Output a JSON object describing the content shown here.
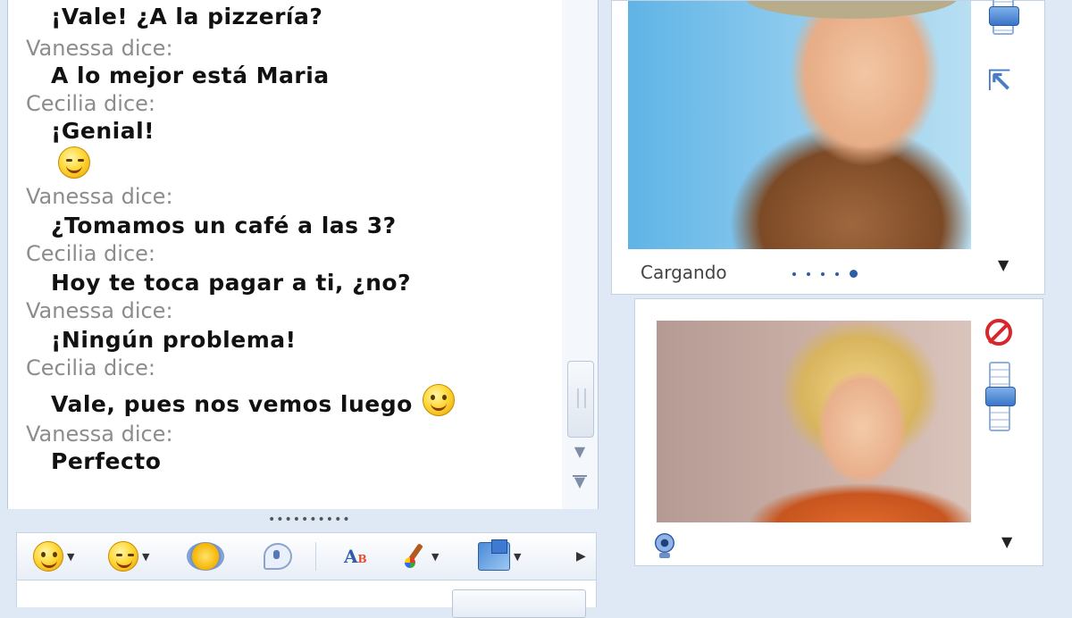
{
  "conversation": {
    "messages": [
      {
        "sender": "",
        "text": "¡Vale! ¿A la pizzería?",
        "emoticon": ""
      },
      {
        "sender": "Vanessa dice:",
        "text": "A lo mejor está Maria",
        "emoticon": ""
      },
      {
        "sender": "Cecilia dice:",
        "text": "¡Genial!",
        "emoticon": "wink"
      },
      {
        "sender": "Vanessa dice:",
        "text": "¿Tomamos un café a las 3?",
        "emoticon": ""
      },
      {
        "sender": "Cecilia dice:",
        "text": "Hoy te toca pagar a ti, ¿no?",
        "emoticon": ""
      },
      {
        "sender": "Vanessa dice:",
        "text": "¡Ningún problema!",
        "emoticon": ""
      },
      {
        "sender": "Cecilia dice:",
        "text": "Vale, pues nos vemos luego",
        "emoticon": "smile"
      },
      {
        "sender": "Vanessa dice:",
        "text": "Perfecto",
        "emoticon": ""
      }
    ]
  },
  "contact_video": {
    "status_text": "Cargando"
  },
  "toolbar": {
    "font_icon_text": "A",
    "font_icon_sub": "B",
    "icons": [
      "smile-emoticon-icon",
      "wink-emoticon-icon",
      "nudge-icon",
      "voice-clip-icon",
      "font-icon",
      "brush-icon",
      "background-icon",
      "more-icon"
    ]
  },
  "colors": {
    "sender": "#8c8c8c",
    "message": "#111111",
    "accent": "#4a7bc7",
    "window_bg": "#dfe9f5"
  }
}
